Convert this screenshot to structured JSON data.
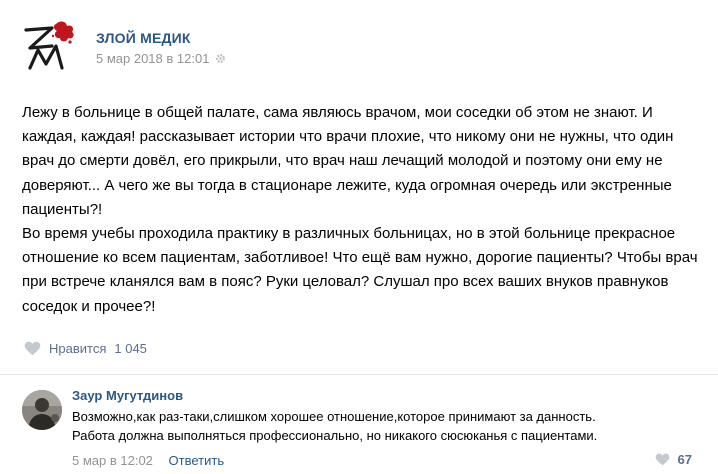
{
  "post": {
    "author": "ЗЛОЙ МЕДИК",
    "date": "5 мар 2018 в 12:01",
    "paragraphs": [
      "Лежу в больнице в общей палате, сама являюсь врачом, мои соседки об этом не знают. И каждая, каждая! рассказывает истории что врачи плохие, что никому они не нужны, что один врач до смерти довёл, его прикрыли, что врач наш лечащий молодой и поэтому они ему не доверяют... А чего же вы тогда в стационаре лежите, куда огромная очередь или экстренные пациенты?!",
      "Во время учебы проходила практику в различных больницах, но в этой больнице прекрасное отношение ко всем пациентам, заботливое! Что ещё вам нужно, дорогие пациенты? Чтобы врач при встрече кланялся вам в пояс? Руки целовал? Слушал про всех ваших внуков правнуков соседок и прочее?!"
    ],
    "like_label": "Нравится",
    "like_count": "1 045"
  },
  "comment": {
    "author": "Заур Мугутдинов",
    "lines": [
      "Возможно,как раз-таки,слишком хорошее отношение,которое принимают за данность.",
      "Работа должна выполняться профессионально, но никакого сюсюканья с пациентами."
    ],
    "date": "5 мар в 12:02",
    "reply_label": "Ответить",
    "like_count": "67"
  },
  "icons": {
    "logo": "zm-logo-icon",
    "settings": "gear-icon",
    "like": "heart-icon"
  },
  "colors": {
    "link": "#2a5885",
    "meta": "#939393",
    "heart": "#c4c8cf",
    "logo_red": "#c0151b"
  }
}
